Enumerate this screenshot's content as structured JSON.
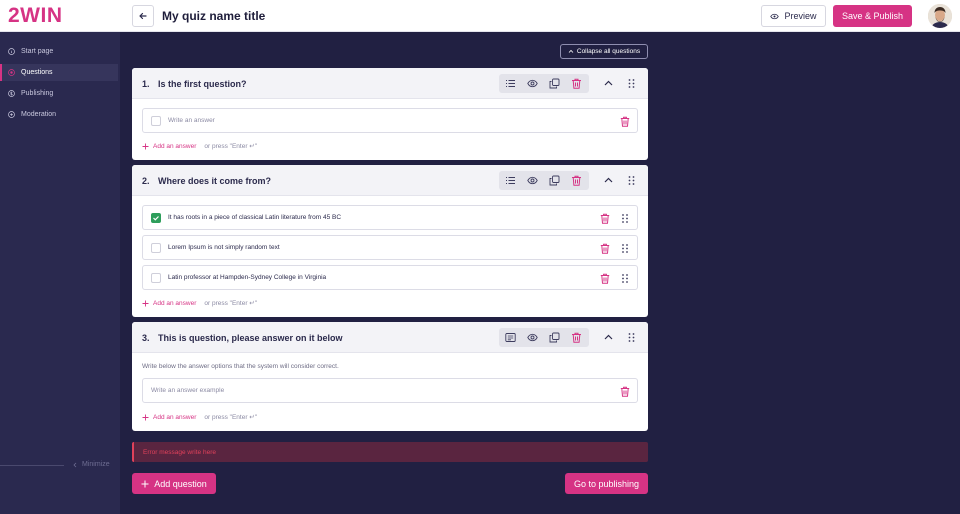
{
  "brand": {
    "logo": "2WIN",
    "accent": "#d63384"
  },
  "header": {
    "title": "My quiz name title",
    "preview_label": "Preview",
    "publish_label": "Save & Publish"
  },
  "sidebar": {
    "items": [
      {
        "label": "Start page",
        "icon": "info-circle-icon",
        "active": false
      },
      {
        "label": "Questions",
        "icon": "target-icon",
        "active": true
      },
      {
        "label": "Publishing",
        "icon": "dollar-circle-icon",
        "active": false
      },
      {
        "label": "Moderation",
        "icon": "plus-circle-icon",
        "active": false
      }
    ],
    "minimize_label": "Minimize"
  },
  "main": {
    "collapse_label": "Collapse all questions",
    "add_answer_label": "Add an answer",
    "press_hint": "or press \"Enter ↵\"",
    "questions": [
      {
        "number": "1.",
        "title": "Is the first question?",
        "type_icon": "list-icon",
        "answers": [
          {
            "text": "",
            "placeholder": "Write an answer",
            "checked": false
          }
        ]
      },
      {
        "number": "2.",
        "title": "Where does it come from?",
        "type_icon": "list-icon",
        "answers": [
          {
            "text": "It has roots in a piece of classical Latin literature from 45 BC",
            "checked": true
          },
          {
            "text": "Lorem Ipsum is not simply random text",
            "checked": false
          },
          {
            "text": "Latin professor at Hampden-Sydney College in Virginia",
            "checked": false
          }
        ]
      },
      {
        "number": "3.",
        "title": "This is question, please answer on it below",
        "type_icon": "text-box-icon",
        "description": "Write below the answer options that the system will consider correct.",
        "answers": [
          {
            "text": "",
            "placeholder": "Write an answer example"
          }
        ]
      }
    ],
    "error_message": "Error message write here",
    "add_question_label": "Add question",
    "go_publishing_label": "Go to publishing"
  }
}
